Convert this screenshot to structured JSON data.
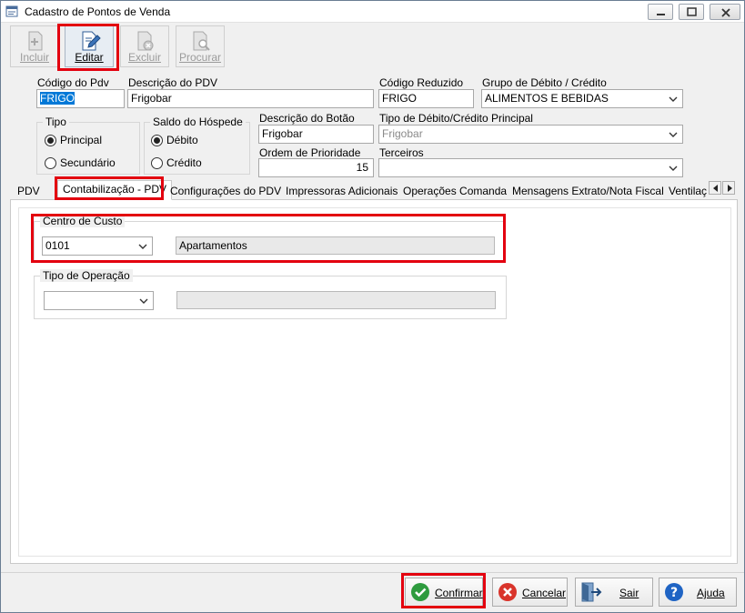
{
  "window": {
    "title": "Cadastro de Pontos de Venda"
  },
  "toolbar": {
    "incluir": "Incluir",
    "editar": "Editar",
    "excluir": "Excluir",
    "procurar": "Procurar"
  },
  "form": {
    "codigo_pdv": {
      "label": "Código do Pdv",
      "value": "FRIGO"
    },
    "descricao_pdv": {
      "label": "Descrição do PDV",
      "value": "Frigobar"
    },
    "codigo_reduzido": {
      "label": "Código Reduzido",
      "value": "FRIGO"
    },
    "grupo_debito_credito": {
      "label": "Grupo de Débito / Crédito",
      "value": "ALIMENTOS E BEBIDAS"
    },
    "tipo": {
      "label": "Tipo",
      "options": [
        "Principal",
        "Secundário"
      ],
      "selected": "Principal"
    },
    "saldo_hospede": {
      "label": "Saldo do Hóspede",
      "options": [
        "Débito",
        "Crédito"
      ],
      "selected": "Débito"
    },
    "descricao_botao": {
      "label": "Descrição do Botão",
      "value": "Frigobar"
    },
    "tipo_debito_credito_principal": {
      "label": "Tipo de Débito/Crédito Principal",
      "value": "Frigobar"
    },
    "ordem_prioridade": {
      "label": "Ordem de Prioridade",
      "value": "15"
    },
    "terceiros": {
      "label": "Terceiros",
      "value": ""
    }
  },
  "tabs": [
    "PDV",
    "Contabilização - PDV",
    "Configurações do PDV",
    "Impressoras Adicionais",
    "Operações Comanda",
    "Mensagens Extrato/Nota Fiscal",
    "Ventilaç"
  ],
  "active_tab": "Contabilização - PDV",
  "contabilizacao": {
    "centro_custo": {
      "label": "Centro de Custo",
      "code": "0101",
      "description": "Apartamentos"
    },
    "tipo_operacao": {
      "label": "Tipo de Operação",
      "code": "",
      "description": ""
    }
  },
  "footer": {
    "confirmar": "Confirmar",
    "cancelar": "Cancelar",
    "sair": "Sair",
    "ajuda": "Ajuda"
  },
  "colors": {
    "highlight_red": "#e3000f",
    "selection_blue": "#0078d7",
    "confirm_green": "#2e9b3e",
    "cancel_red": "#d9342b",
    "help_blue": "#1f64c4"
  }
}
